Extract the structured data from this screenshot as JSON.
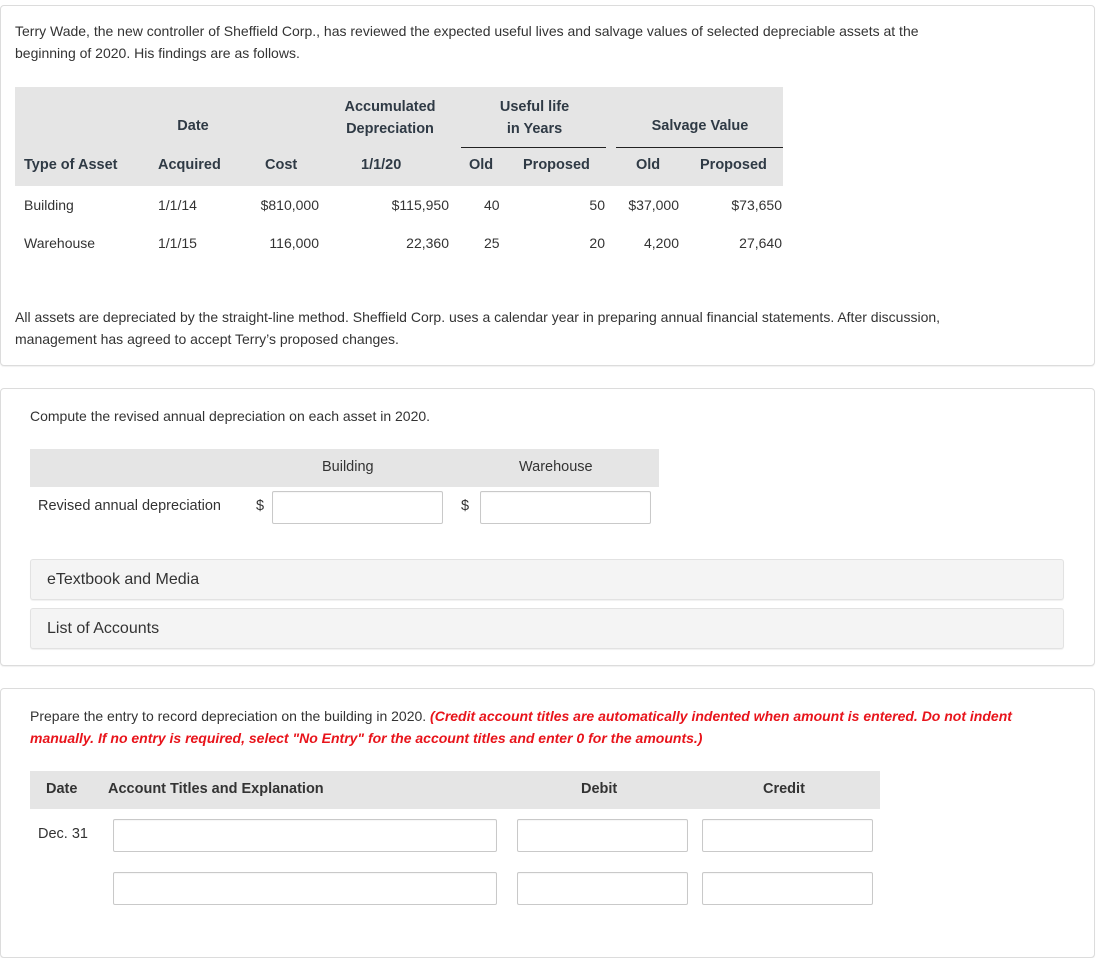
{
  "intro": {
    "text": "Terry Wade, the new controller of Sheffield Corp., has reviewed the expected useful lives and salvage values of selected depreciable assets at the beginning of 2020. His findings are as follows.",
    "line1": "Terry Wade, the new controller of Sheffield Corp., has reviewed the expected useful lives and salvage values of selected depreciable assets at the",
    "line2": "beginning of 2020. His findings are as follows."
  },
  "asset_table": {
    "group_headers": {
      "date": "Date",
      "accum_line1": "Accumulated",
      "accum_line2": "Depreciation",
      "life_line1": "Useful life",
      "life_line2": "in Years",
      "salvage": "Salvage Value"
    },
    "columns": [
      "Type of Asset",
      "Acquired",
      "Cost",
      "1/1/20",
      "Old",
      "Proposed",
      "Old",
      "Proposed"
    ],
    "rows": [
      {
        "type": "Building",
        "acquired": "1/1/14",
        "cost": "$810,000",
        "accum": "$115,950",
        "life_old": "40",
        "life_proposed": "50",
        "salvage_old": "$37,000",
        "salvage_proposed": "$73,650"
      },
      {
        "type": "Warehouse",
        "acquired": "1/1/15",
        "cost": "116,000",
        "accum": "22,360",
        "life_old": "25",
        "life_proposed": "20",
        "salvage_old": "4,200",
        "salvage_proposed": "27,640"
      }
    ]
  },
  "notes": {
    "line1": "All assets are depreciated by the straight-line method. Sheffield Corp. uses a calendar year in preparing annual financial statements. After discussion,",
    "line2": "management has agreed to accept Terry’s proposed changes."
  },
  "part_a": {
    "prompt": "Compute the revised annual depreciation on each asset in 2020.",
    "headers": [
      "Building",
      "Warehouse"
    ],
    "row_label": "Revised annual depreciation",
    "currency": "$",
    "building_value": "",
    "warehouse_value": ""
  },
  "resources": {
    "etextbook": "eTextbook and Media",
    "accounts": "List of Accounts"
  },
  "part_b": {
    "prompt": "Prepare the entry to record depreciation on the building in 2020.",
    "instruction_line1": "(Credit account titles are automatically indented when amount is entered. Do not indent",
    "instruction_line2": "manually. If no entry is required, select \"No Entry\" for the account titles and enter 0 for the amounts.)",
    "headers": {
      "date": "Date",
      "account": "Account Titles and Explanation",
      "debit": "Debit",
      "credit": "Credit"
    },
    "rows": [
      {
        "date": "Dec. 31",
        "account": "",
        "debit": "",
        "credit": ""
      },
      {
        "date": "",
        "account": "",
        "debit": "",
        "credit": ""
      }
    ]
  },
  "colors": {
    "header_bg": "#e5e5e5",
    "instruction_red": "#e8141b",
    "accordion_bg": "#f4f4f4"
  }
}
